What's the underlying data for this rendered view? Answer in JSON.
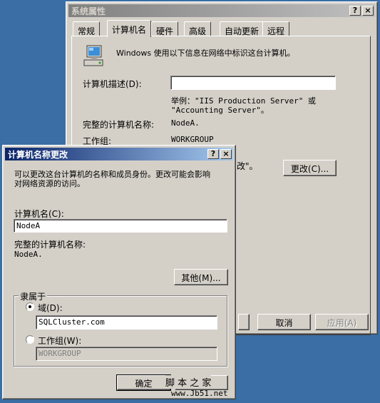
{
  "sys_props": {
    "title": "系统属性",
    "tabs": [
      "常规",
      "计算机名",
      "硬件",
      "高级",
      "自动更新",
      "远程"
    ],
    "intro": "Windows 使用以下信息在网络中标识这台计算机。",
    "desc_label": "计算机描述(D):",
    "desc_value": "",
    "example": "举例：\"IIS Production Server\" 或",
    "example2": "\"Accounting Server\"。",
    "fullname_label": "完整的计算机名称:",
    "fullname_value": "NodeA.",
    "workgroup_label": "工作组:",
    "workgroup_value": "WORKGROUP",
    "change_tail": "改\"。",
    "change_button": "更改(C)...",
    "cancel_button": "取消",
    "apply_button": "应用(A)"
  },
  "dialog": {
    "title": "计算机名称更改",
    "help_btn": "?",
    "close_btn": "×",
    "intro_line1": "可以更改这台计算机的名称和成员身份。更改可能会影响",
    "intro_line2": "对网络资源的访问。",
    "name_label": "计算机名(C):",
    "name_value": "NodeA",
    "fullname_label": "完整的计算机名称:",
    "fullname_value": "NodeA.",
    "more_button": "其他(M)...",
    "member_label": "隶属于",
    "domain_label": "域(D):",
    "domain_value": "SQLCluster.com",
    "workgroup_label": "工作组(W):",
    "workgroup_value": "WORKGROUP",
    "ok_button": "确定"
  },
  "watermark": {
    "text": "脚 本 之 家",
    "url": "www.Jb51.net"
  }
}
